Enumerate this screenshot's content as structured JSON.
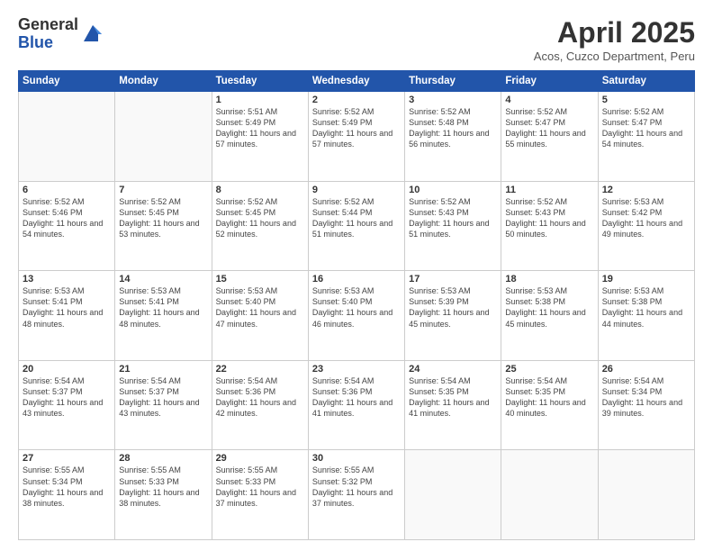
{
  "logo": {
    "general": "General",
    "blue": "Blue"
  },
  "header": {
    "title": "April 2025",
    "subtitle": "Acos, Cuzco Department, Peru"
  },
  "weekdays": [
    "Sunday",
    "Monday",
    "Tuesday",
    "Wednesday",
    "Thursday",
    "Friday",
    "Saturday"
  ],
  "weeks": [
    [
      {
        "day": "",
        "info": ""
      },
      {
        "day": "",
        "info": ""
      },
      {
        "day": "1",
        "info": "Sunrise: 5:51 AM\nSunset: 5:49 PM\nDaylight: 11 hours and 57 minutes."
      },
      {
        "day": "2",
        "info": "Sunrise: 5:52 AM\nSunset: 5:49 PM\nDaylight: 11 hours and 57 minutes."
      },
      {
        "day": "3",
        "info": "Sunrise: 5:52 AM\nSunset: 5:48 PM\nDaylight: 11 hours and 56 minutes."
      },
      {
        "day": "4",
        "info": "Sunrise: 5:52 AM\nSunset: 5:47 PM\nDaylight: 11 hours and 55 minutes."
      },
      {
        "day": "5",
        "info": "Sunrise: 5:52 AM\nSunset: 5:47 PM\nDaylight: 11 hours and 54 minutes."
      }
    ],
    [
      {
        "day": "6",
        "info": "Sunrise: 5:52 AM\nSunset: 5:46 PM\nDaylight: 11 hours and 54 minutes."
      },
      {
        "day": "7",
        "info": "Sunrise: 5:52 AM\nSunset: 5:45 PM\nDaylight: 11 hours and 53 minutes."
      },
      {
        "day": "8",
        "info": "Sunrise: 5:52 AM\nSunset: 5:45 PM\nDaylight: 11 hours and 52 minutes."
      },
      {
        "day": "9",
        "info": "Sunrise: 5:52 AM\nSunset: 5:44 PM\nDaylight: 11 hours and 51 minutes."
      },
      {
        "day": "10",
        "info": "Sunrise: 5:52 AM\nSunset: 5:43 PM\nDaylight: 11 hours and 51 minutes."
      },
      {
        "day": "11",
        "info": "Sunrise: 5:52 AM\nSunset: 5:43 PM\nDaylight: 11 hours and 50 minutes."
      },
      {
        "day": "12",
        "info": "Sunrise: 5:53 AM\nSunset: 5:42 PM\nDaylight: 11 hours and 49 minutes."
      }
    ],
    [
      {
        "day": "13",
        "info": "Sunrise: 5:53 AM\nSunset: 5:41 PM\nDaylight: 11 hours and 48 minutes."
      },
      {
        "day": "14",
        "info": "Sunrise: 5:53 AM\nSunset: 5:41 PM\nDaylight: 11 hours and 48 minutes."
      },
      {
        "day": "15",
        "info": "Sunrise: 5:53 AM\nSunset: 5:40 PM\nDaylight: 11 hours and 47 minutes."
      },
      {
        "day": "16",
        "info": "Sunrise: 5:53 AM\nSunset: 5:40 PM\nDaylight: 11 hours and 46 minutes."
      },
      {
        "day": "17",
        "info": "Sunrise: 5:53 AM\nSunset: 5:39 PM\nDaylight: 11 hours and 45 minutes."
      },
      {
        "day": "18",
        "info": "Sunrise: 5:53 AM\nSunset: 5:38 PM\nDaylight: 11 hours and 45 minutes."
      },
      {
        "day": "19",
        "info": "Sunrise: 5:53 AM\nSunset: 5:38 PM\nDaylight: 11 hours and 44 minutes."
      }
    ],
    [
      {
        "day": "20",
        "info": "Sunrise: 5:54 AM\nSunset: 5:37 PM\nDaylight: 11 hours and 43 minutes."
      },
      {
        "day": "21",
        "info": "Sunrise: 5:54 AM\nSunset: 5:37 PM\nDaylight: 11 hours and 43 minutes."
      },
      {
        "day": "22",
        "info": "Sunrise: 5:54 AM\nSunset: 5:36 PM\nDaylight: 11 hours and 42 minutes."
      },
      {
        "day": "23",
        "info": "Sunrise: 5:54 AM\nSunset: 5:36 PM\nDaylight: 11 hours and 41 minutes."
      },
      {
        "day": "24",
        "info": "Sunrise: 5:54 AM\nSunset: 5:35 PM\nDaylight: 11 hours and 41 minutes."
      },
      {
        "day": "25",
        "info": "Sunrise: 5:54 AM\nSunset: 5:35 PM\nDaylight: 11 hours and 40 minutes."
      },
      {
        "day": "26",
        "info": "Sunrise: 5:54 AM\nSunset: 5:34 PM\nDaylight: 11 hours and 39 minutes."
      }
    ],
    [
      {
        "day": "27",
        "info": "Sunrise: 5:55 AM\nSunset: 5:34 PM\nDaylight: 11 hours and 38 minutes."
      },
      {
        "day": "28",
        "info": "Sunrise: 5:55 AM\nSunset: 5:33 PM\nDaylight: 11 hours and 38 minutes."
      },
      {
        "day": "29",
        "info": "Sunrise: 5:55 AM\nSunset: 5:33 PM\nDaylight: 11 hours and 37 minutes."
      },
      {
        "day": "30",
        "info": "Sunrise: 5:55 AM\nSunset: 5:32 PM\nDaylight: 11 hours and 37 minutes."
      },
      {
        "day": "",
        "info": ""
      },
      {
        "day": "",
        "info": ""
      },
      {
        "day": "",
        "info": ""
      }
    ]
  ]
}
